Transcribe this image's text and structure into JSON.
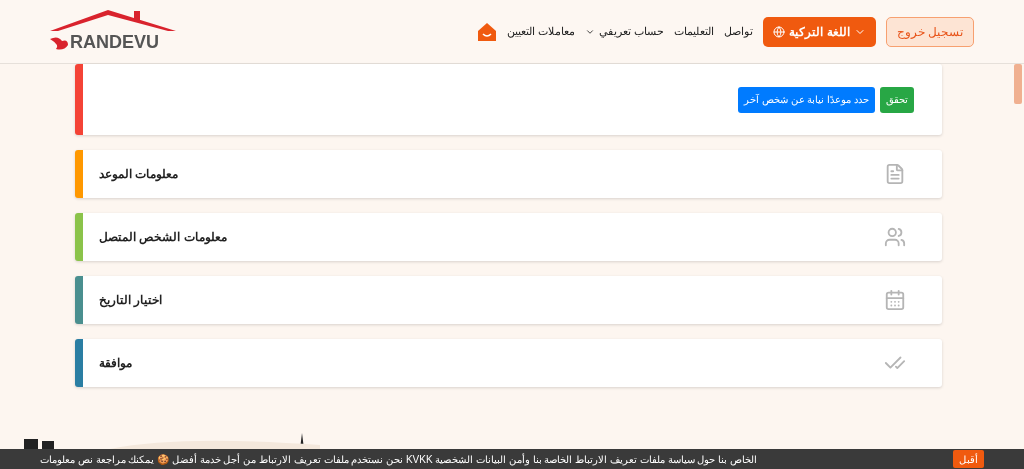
{
  "logo": {
    "text": "RANDEVU"
  },
  "nav": {
    "logout": "تسجيل خروج",
    "language": "اللغة التركية",
    "links": [
      {
        "label": "تواصل",
        "dropdown": false
      },
      {
        "label": "التعليمات",
        "dropdown": false
      },
      {
        "label": "حساب تعريفي",
        "dropdown": true
      },
      {
        "label": "معاملات التعيين",
        "dropdown": false
      }
    ]
  },
  "verify_card": {
    "color": "#f44336",
    "buttons": [
      {
        "label": "تحقق",
        "kind": "success"
      },
      {
        "label": "حدد موعدًا نيابة عن شخص آخر",
        "kind": "primary"
      }
    ]
  },
  "steps": [
    {
      "title": "معلومات الموعد",
      "color": "#ff9800",
      "kind": "document"
    },
    {
      "title": "معلومات الشخص المتصل",
      "color": "#8bc34a",
      "kind": "people"
    },
    {
      "title": "اختيار التاريخ",
      "color": "#4a8f8f",
      "kind": "calendar"
    },
    {
      "title": "موافقة",
      "color": "#2a7ea3",
      "kind": "check"
    }
  ],
  "cookie_bar": {
    "text": "الخاص بنا حول سياسة ملفات تعريف الارتباط الخاصة بنا وأمن البيانات الشخصية KVKK نحن نستخدم ملفات تعريف الارتباط من أجل خدمة أفضل 🍪 يمكنك مراجعة نص معلومات",
    "button": "أقبل"
  }
}
